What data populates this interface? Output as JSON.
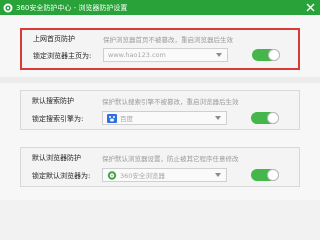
{
  "window": {
    "title": "360安全防护中心 - 浏览器防护设置"
  },
  "sections": [
    {
      "title": "上网首页防护",
      "description": "保护浏览器首页不被篡改，重启浏览器后生效",
      "select_label": "锁定浏览器主页为:",
      "select_value": "www.hao123.com",
      "select_icon": "none",
      "toggle_on": true
    },
    {
      "title": "默认搜索防护",
      "description": "保护默认搜索引擎不被篡改，重启浏览器后生效",
      "select_label": "锁定搜索引擎为:",
      "select_value": "百度",
      "select_icon": "baidu-icon",
      "toggle_on": true
    },
    {
      "title": "默认浏览器防护",
      "description": "保护默认浏览器设置，防止被其它程序任意修改",
      "select_label": "锁定默认浏览器为:",
      "select_value": "360安全浏览器",
      "select_icon": "360-browser-icon",
      "toggle_on": true
    }
  ],
  "colors": {
    "titlebar": "#2aa23a",
    "toggle_on": "#45b649",
    "highlight_border": "#d83a3a"
  }
}
